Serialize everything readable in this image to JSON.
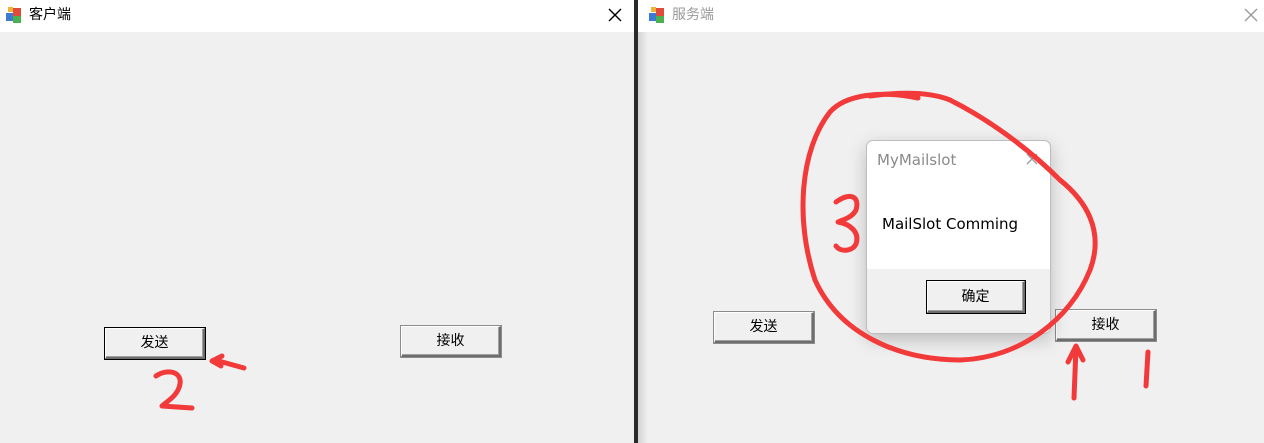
{
  "client_window": {
    "title": "客户端",
    "send_label": "发送",
    "receive_label": "接收"
  },
  "server_window": {
    "title": "服务端",
    "send_label": "发送",
    "receive_label": "接收"
  },
  "message_box": {
    "title": "MyMailslot",
    "message": "MailSlot Comming",
    "ok_label": "确定"
  },
  "annotations": {
    "color": "#f23a3a",
    "step_numbers": [
      "1",
      "2",
      "3"
    ]
  },
  "icons": [
    "app-icon",
    "close-icon",
    "arrow-annotation"
  ]
}
